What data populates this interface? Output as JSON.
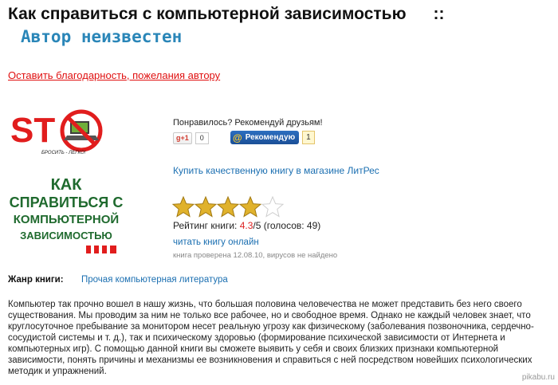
{
  "header": {
    "title": "Как справиться с компьютерной зависимостью",
    "separator": "::",
    "author": "Автор неизвестен"
  },
  "thanks_link": "Оставить благодарность, пожелания автору",
  "cover": {
    "stop_text": "ST  P",
    "stop_sub": "БРОСИТЬ - ЛЕГКО!",
    "line1": "КАК",
    "line2": "СПРАВИТЬСЯ С",
    "line3": "КОМПЬЮТЕРНОЙ",
    "line4": "ЗАВИСИМОСТЬЮ"
  },
  "share": {
    "prompt": "Понравилось? Рекомендуй друзьям!",
    "gplus_label": "+1",
    "gplus_count": "0",
    "mail_label": "Рекомендую",
    "mail_count": "1"
  },
  "buy_link": "Купить качественную книгу в магазине ЛитРес",
  "rating": {
    "value": 4.3,
    "max": 5,
    "stars_filled": 4,
    "prefix": "Рейтинг книги: ",
    "value_text": "4.3",
    "suffix": "/5 (голосов: 49)"
  },
  "read_link": "читать книгу онлайн",
  "checked_text": "книга проверена 12.08.10, вирусов не найдено",
  "genre": {
    "label": "Жанр книги:",
    "value": "Прочая компьютерная литература"
  },
  "description": "Компьютер так прочно вошел в нашу жизнь, что большая половина человечества не может представить без него своего существования. Мы проводим за ним не только все рабочее, но и свободное время. Однако не каждый человек знает, что круглосуточное пребывание за монитором несет реальную угрозу как физическому (заболевания позвоночника, сердечно-сосудистой системы и т. д.), так и психическому здоровью (формирование психической зависимости от Интернета и компьютерных игр). С помощью данной книги вы сможете выявить у себя и своих близких признаки компьютерной зависимости, понять причины и механизмы ее возникновения и справиться с ней посредством новейших психологических методик и упражнений.",
  "watermark": "pikabu.ru",
  "colors": {
    "author": "#2a86b8",
    "link_red": "#e01010",
    "link_blue": "#1b6fb1",
    "star": "#e0b22c"
  }
}
